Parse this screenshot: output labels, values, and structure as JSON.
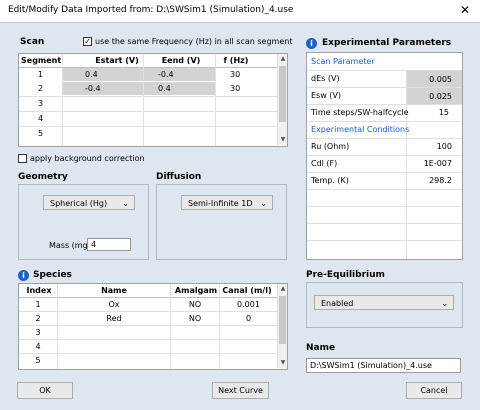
{
  "window": {
    "title": "Edit/Modify Data Imported from:  D:\\SWSim1 (Simulation)_4.use",
    "close": "✕"
  },
  "scan": {
    "title": "Scan",
    "same_freq_label": "use the same Frequency (Hz) in all scan segment",
    "same_freq_checked": true,
    "headers": [
      "Segment",
      "Estart (V)",
      "Eend (V)",
      "f (Hz)"
    ],
    "rows": [
      {
        "n": "1",
        "estart": "0.4",
        "eend": "-0.4",
        "f": "30"
      },
      {
        "n": "2",
        "estart": "-0.4",
        "eend": "0.4",
        "f": "30"
      },
      {
        "n": "3",
        "estart": "",
        "eend": "",
        "f": ""
      },
      {
        "n": "4",
        "estart": "",
        "eend": "",
        "f": ""
      },
      {
        "n": "5",
        "estart": "",
        "eend": "",
        "f": ""
      }
    ]
  },
  "background_correction": {
    "label": "apply background correction",
    "checked": false
  },
  "geometry": {
    "title": "Geometry",
    "value": "Spherical (Hg)",
    "mass_label": "Mass (mg)",
    "mass_value": "4"
  },
  "diffusion": {
    "title": "Diffusion",
    "value": "Semi-Infinite 1D"
  },
  "experimental": {
    "title": "Experimental Parameters",
    "scan_parameter_header": "Scan Parameter",
    "des_label": "dEs (V)",
    "des_value": "0.005",
    "esw_label": "Esw (V)",
    "esw_value": "0.025",
    "steps_label": "Time steps/SW-halfcycle",
    "steps_value": "15",
    "conditions_header": "Experimental Conditions",
    "ru_label": "Ru (Ohm)",
    "ru_value": "100",
    "cdl_label": "Cdl (F)",
    "cdl_value": "1E-007",
    "temp_label": "Temp. (K)",
    "temp_value": "298.2"
  },
  "species": {
    "title": "Species",
    "headers": [
      "Index",
      "Name",
      "Amalgam",
      "Canal (m/l)"
    ],
    "rows": [
      {
        "i": "1",
        "name": "Ox",
        "amalgam": "NO",
        "canal": "0.001"
      },
      {
        "i": "2",
        "name": "Red",
        "amalgam": "NO",
        "canal": "0"
      },
      {
        "i": "3",
        "name": "",
        "amalgam": "",
        "canal": ""
      },
      {
        "i": "4",
        "name": "",
        "amalgam": "",
        "canal": ""
      },
      {
        "i": "5",
        "name": "",
        "amalgam": "",
        "canal": ""
      }
    ]
  },
  "pre_equilibrium": {
    "title": "Pre-Equilibrium",
    "value": "Enabled"
  },
  "name": {
    "title": "Name",
    "value": "D:\\SWSim1 (Simulation)_4.use"
  },
  "buttons": {
    "ok": "OK",
    "next": "Next Curve",
    "cancel": "Cancel"
  },
  "icons": {
    "info": "i",
    "dropdown": "⌄",
    "scroll_up": "▲",
    "scroll_down": "▼"
  }
}
